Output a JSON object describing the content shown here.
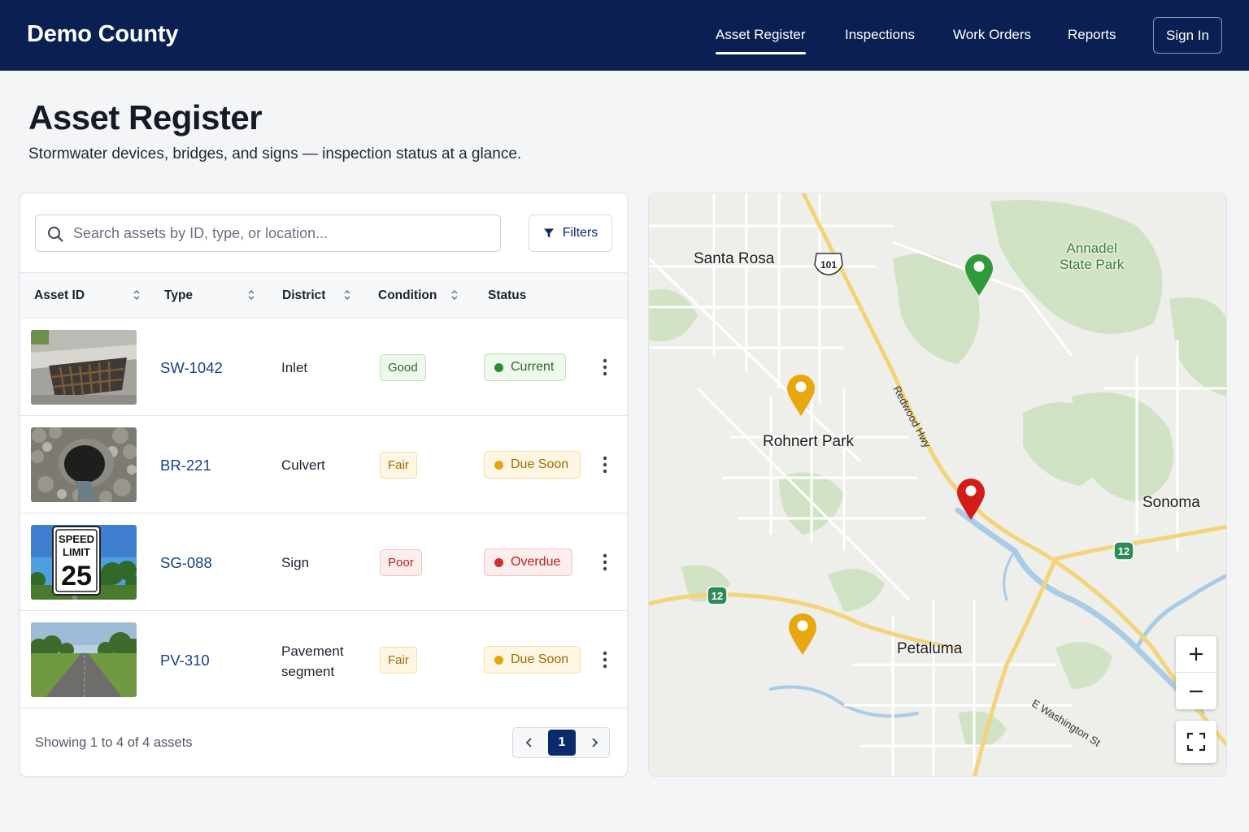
{
  "header": {
    "brand": "Demo County",
    "nav": [
      "Asset Register",
      "Inspections",
      "Work Orders",
      "Reports"
    ],
    "active_nav": "Asset Register",
    "sign_in": "Sign In"
  },
  "page": {
    "title": "Asset Register",
    "subtitle": "Stormwater devices, bridges, and signs — inspection status at a glance."
  },
  "table_card": {
    "search_placeholder": "Search assets by ID, type, or location...",
    "filters_label": "Filters",
    "columns": [
      "Asset ID",
      "Type",
      "District",
      "Condition",
      "Status"
    ],
    "rows": [
      {
        "asset_id": "SW-1042",
        "type": "Inlet",
        "condition": "Good",
        "status": "Current",
        "thumb": "storm-drain-inlet"
      },
      {
        "asset_id": "BR-221",
        "type": "Culvert",
        "condition": "Fair",
        "status": "Due Soon",
        "thumb": "culvert-pipe"
      },
      {
        "asset_id": "SG-088",
        "type": "Sign",
        "condition": "Poor",
        "status": "Overdue",
        "thumb": "speed-limit-sign",
        "sign_lines": [
          "SPEED",
          "LIMIT",
          "25"
        ]
      },
      {
        "asset_id": "PV-310",
        "type_lines": [
          "Pavement",
          "segment"
        ],
        "condition": "Fair",
        "status": "Due Soon",
        "thumb": "paved-road"
      }
    ],
    "footer": "Showing 1 to 4 of 4 assets",
    "current_page": "1"
  },
  "map": {
    "labels": {
      "santa_rosa": "Santa Rosa",
      "rohnert_park": "Rohnert Park",
      "sonoma": "Sonoma",
      "petaluma": "Petaluma",
      "annadel_1": "Annadel",
      "annadel_2": "State Park",
      "redwood_hwy": "Redwood Hwy",
      "e_washington": "E Washington St",
      "shield_101": "101",
      "shield_12a": "12",
      "shield_12b": "12"
    },
    "markers": [
      {
        "name": "green",
        "color": "#2e9a3a"
      },
      {
        "name": "yellow-1",
        "color": "#e8a70c"
      },
      {
        "name": "red",
        "color": "#d51a1a"
      },
      {
        "name": "yellow-2",
        "color": "#e8a70c"
      }
    ],
    "colors": {
      "water": "#a9cbe8",
      "park": "#cfe2c2",
      "highway": "#f3d479",
      "road": "#ffffff"
    }
  }
}
